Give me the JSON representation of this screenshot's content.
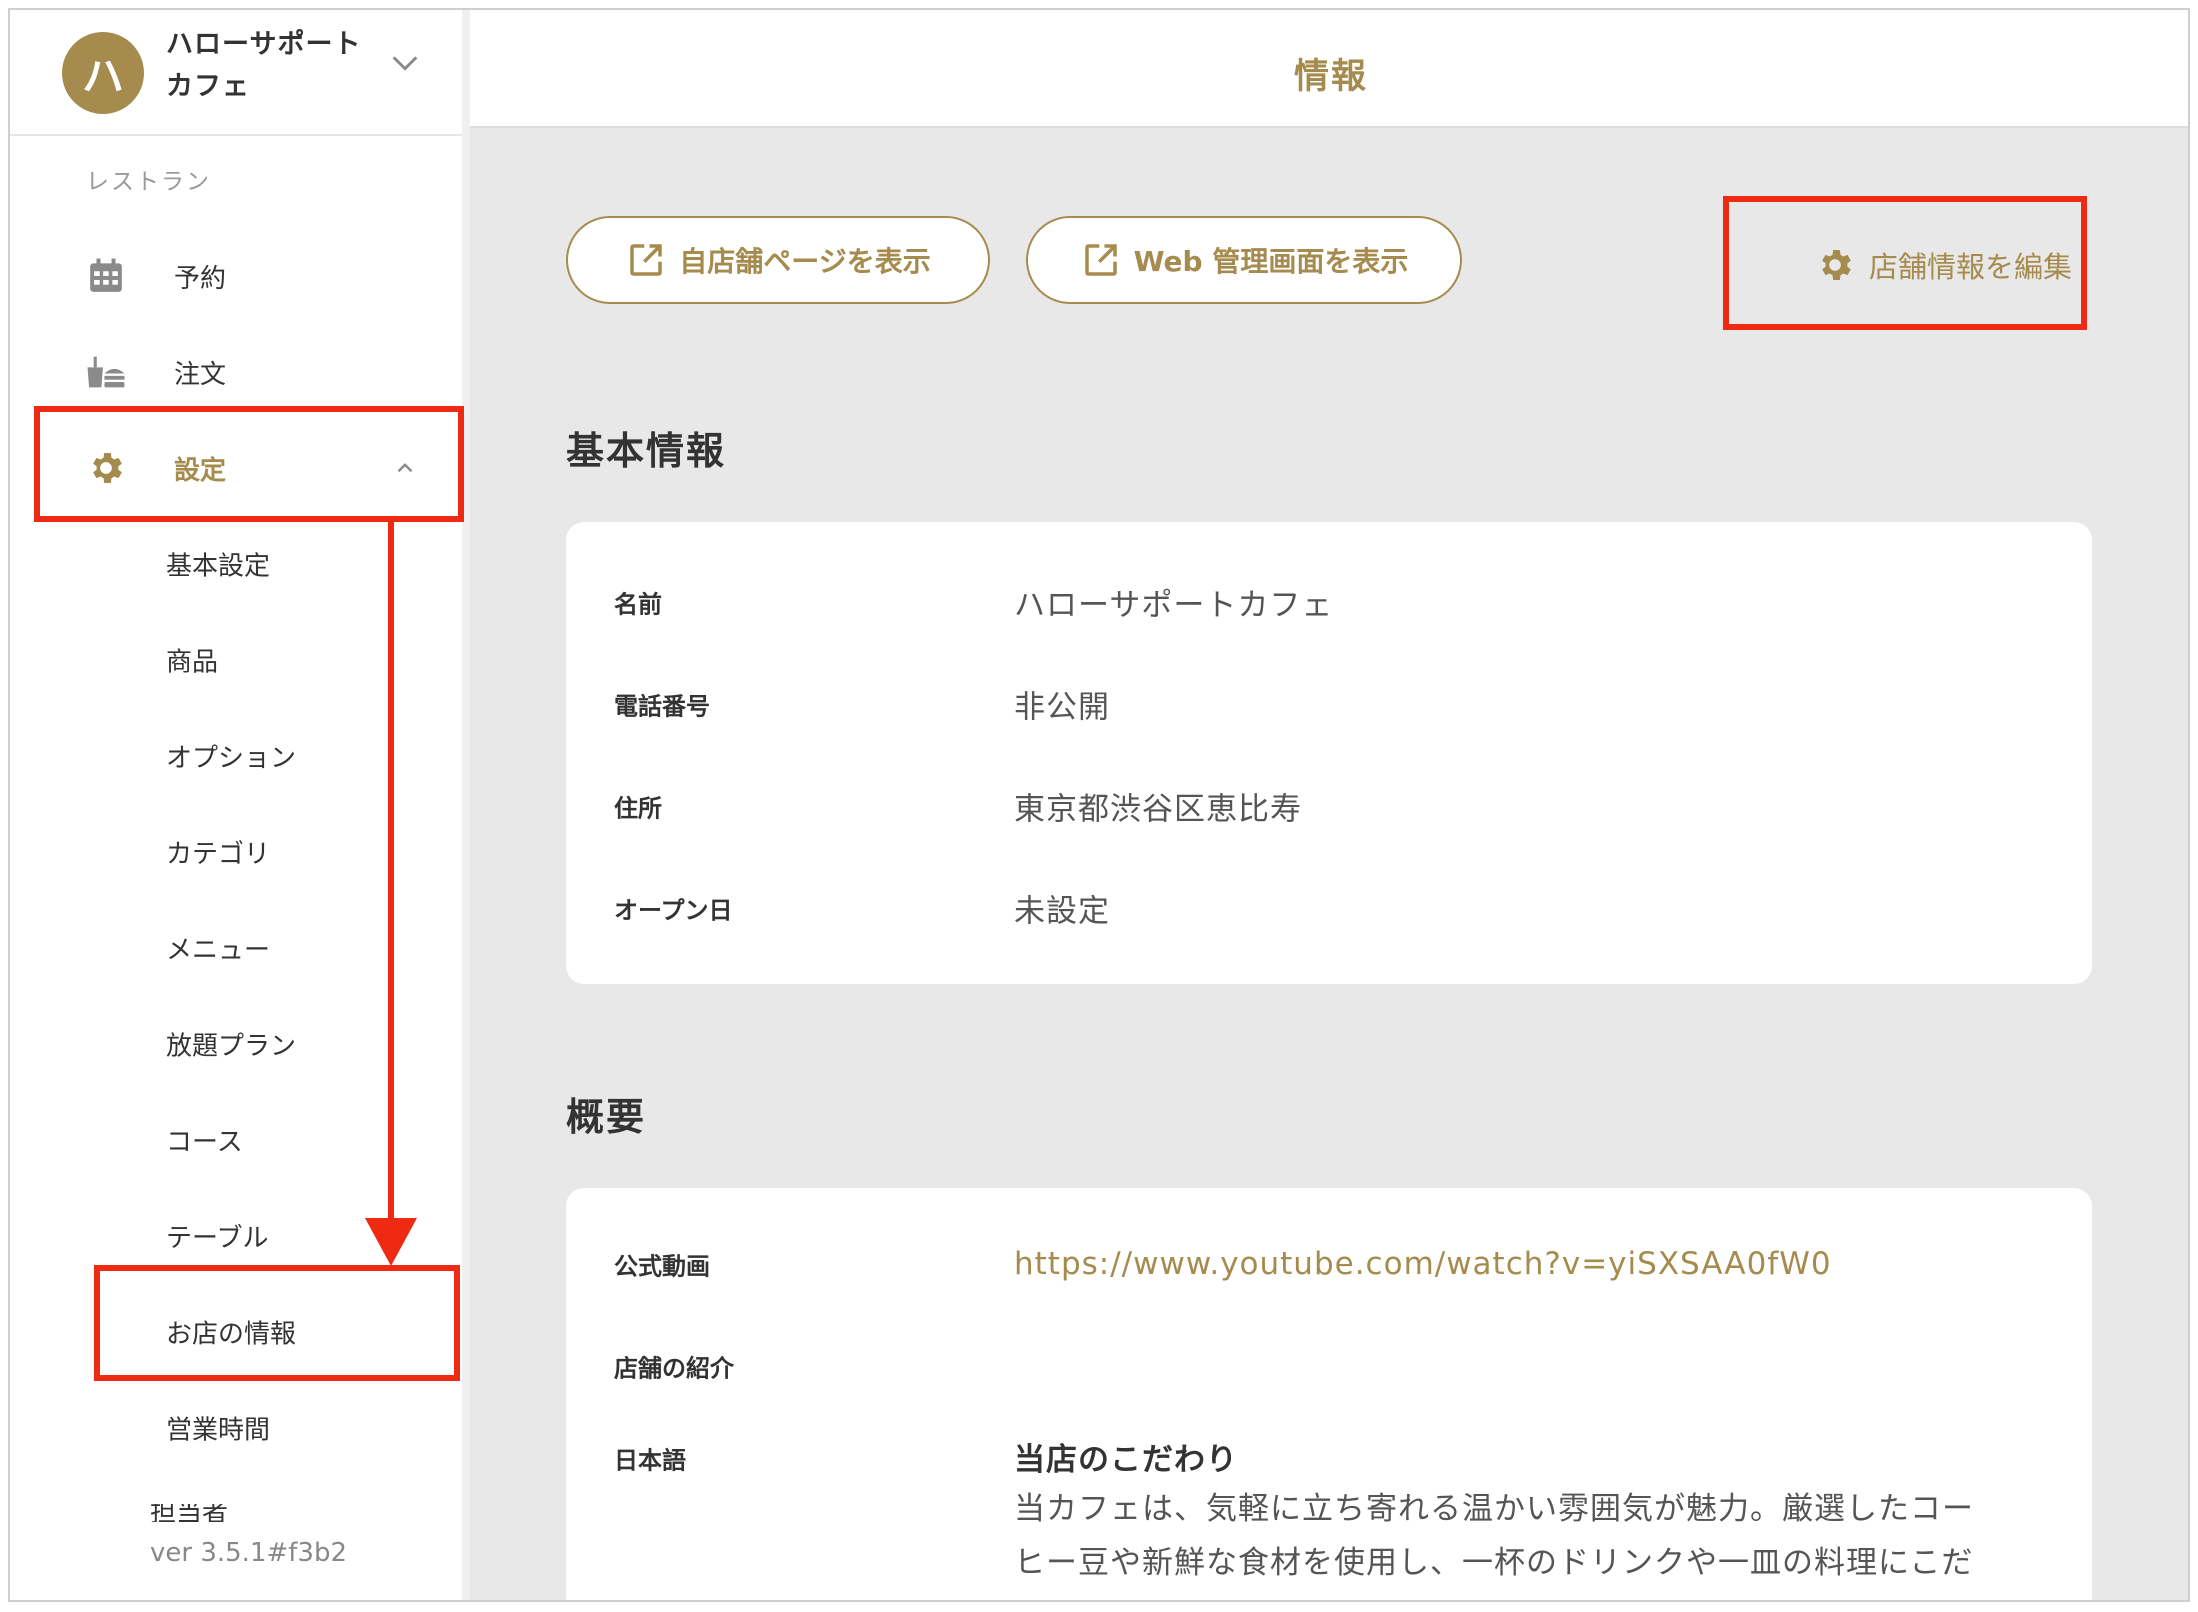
{
  "account": {
    "avatar_initial": "ハ",
    "name": "ハローサポートカフェ"
  },
  "sidebar": {
    "section_label": "レストラン",
    "nav": [
      {
        "label": "予約",
        "icon": "calendar-icon"
      },
      {
        "label": "注文",
        "icon": "order-icon"
      },
      {
        "label": "設定",
        "icon": "gear-icon"
      }
    ],
    "settings_sub": [
      "基本設定",
      "商品",
      "オプション",
      "カテゴリ",
      "メニュー",
      "放題プラン",
      "コース",
      "テーブル",
      "お店の情報",
      "営業時間",
      "担当者"
    ],
    "version": "ver 3.5.1#f3b2"
  },
  "header": {
    "title": "情報"
  },
  "actions": {
    "view_store_page": "自店舗ページを表示",
    "view_web_admin": "Web 管理画面を表示",
    "edit_store_info": "店舗情報を編集"
  },
  "basic_info": {
    "title": "基本情報",
    "rows": [
      {
        "label": "名前",
        "value": "ハローサポートカフェ"
      },
      {
        "label": "電話番号",
        "value": "非公開"
      },
      {
        "label": "住所",
        "value": "東京都渋谷区恵比寿"
      },
      {
        "label": "オープン日",
        "value": "未設定"
      }
    ]
  },
  "overview": {
    "title": "概要",
    "video_label": "公式動画",
    "video_url": "https://www.youtube.com/watch?v=yiSXSAA0fW0",
    "intro_label": "店舗の紹介",
    "lang_label": "日本語",
    "intro_heading": "当店のこだわり",
    "intro_line1": "当カフェは、気軽に立ち寄れる温かい雰囲気が魅力。厳選したコー",
    "intro_line2": "ヒー豆や新鮮な食材を使用し、一杯のドリンクや一皿の料理にこだ"
  },
  "colors": {
    "accent": "#a68b4e",
    "highlight": "#ee2a12",
    "main_bg": "#e8e8e8"
  }
}
